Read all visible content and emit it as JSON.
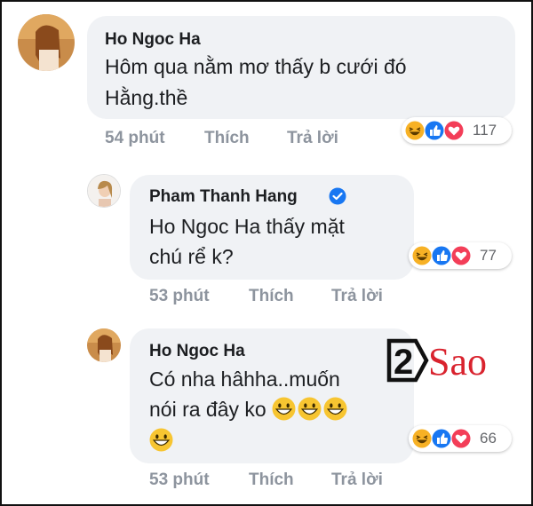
{
  "comments": [
    {
      "author": "Ho Ngoc Ha",
      "text_line1": "Hôm qua nằm mơ thấy b cưới đó",
      "text_line2": "Hằng.thề",
      "time": "54 phút",
      "like_label": "Thích",
      "reply_label": "Trả lời",
      "reaction_count": "117",
      "reactions": [
        "haha-icon",
        "like-icon",
        "love-icon"
      ]
    },
    {
      "author": "Pham Thanh Hang",
      "verified": true,
      "mention": "Ho Ngoc Ha",
      "text_line1_rest": " thấy mặt",
      "text_line2": "chú rể k?",
      "time": "53 phút",
      "like_label": "Thích",
      "reply_label": "Trả lời",
      "reaction_count": "77",
      "reactions": [
        "haha-icon",
        "like-icon",
        "love-icon"
      ]
    },
    {
      "author": "Ho Ngoc Ha",
      "text_line1": "Có nha hâhha..muốn",
      "text_line2": "nói ra đây ko",
      "emoji_line2": [
        "grinning-icon",
        "grinning-icon",
        "grinning-icon"
      ],
      "emoji_line3": [
        "grinning-icon"
      ],
      "time": "53 phút",
      "like_label": "Thích",
      "reply_label": "Trả lời",
      "reaction_count": "66",
      "reactions": [
        "haha-icon",
        "like-icon",
        "love-icon"
      ]
    }
  ],
  "watermark": {
    "number": "2",
    "word": "Sao",
    "colors": {
      "box": "#111111",
      "text": "#d9232e"
    }
  },
  "colors": {
    "bubble": "#f0f2f5",
    "meta": "#8d949e",
    "like": "#1877f2",
    "love": "#f33e58",
    "haha": "#f7b125"
  }
}
